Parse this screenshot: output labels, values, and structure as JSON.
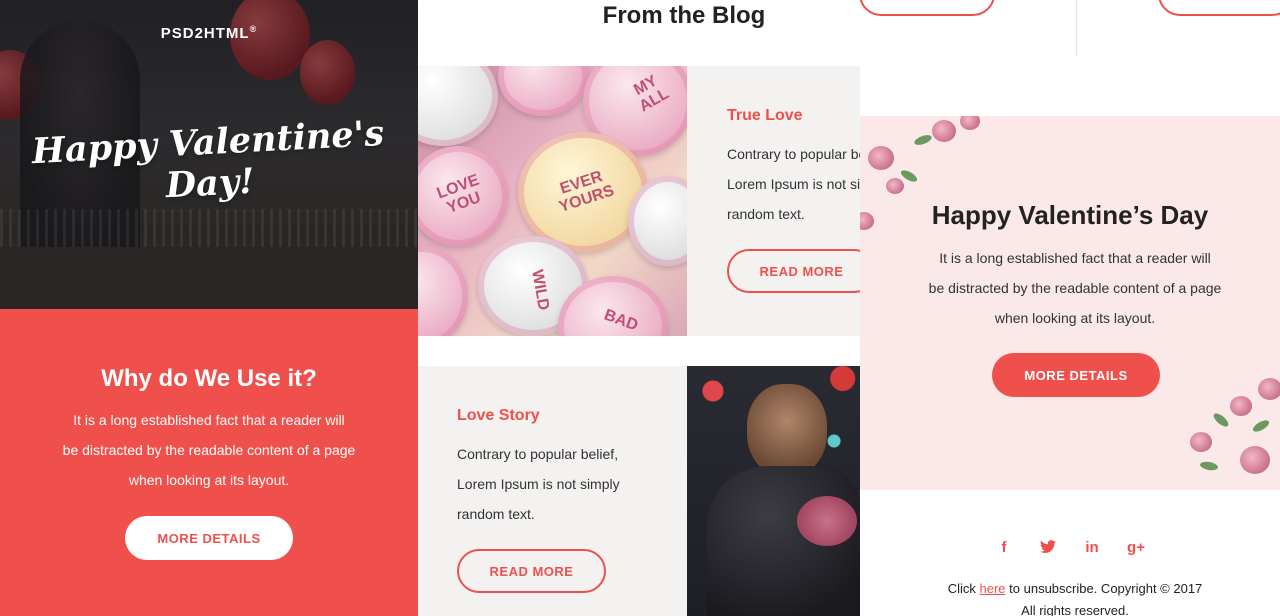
{
  "hero": {
    "logo": "PSD2HTML",
    "logo_mark": "®",
    "title": "Happy Valentine's Day!"
  },
  "why": {
    "title": "Why do We Use it?",
    "text": [
      "It is a long established fact that a reader will",
      "be distracted by the readable content of a page",
      "when looking at its layout."
    ],
    "button": "MORE DETAILS"
  },
  "blog": {
    "title": "From the Blog",
    "candy_words": [
      "EVER YOURS",
      "LOVE YOU",
      "BAD",
      "MY ALL",
      "WILD"
    ],
    "posts": [
      {
        "title": "True Love",
        "text": [
          "Contrary to popular belief,",
          "Lorem Ipsum is not simply",
          "random text."
        ],
        "button": "READ MORE"
      },
      {
        "title": "Love Story",
        "text": [
          "Contrary to popular belief,",
          "Lorem Ipsum is not simply",
          "random text."
        ],
        "button": "READ MORE"
      }
    ]
  },
  "promo": {
    "title": "Happy Valentine’s Day",
    "text": [
      "It is a long established fact that a reader will",
      "be distracted by the readable content of a page",
      "when looking at its layout."
    ],
    "button": "MORE DETAILS"
  },
  "social": {
    "icons": [
      "facebook-icon",
      "twitter-icon",
      "linkedin-icon",
      "google-plus-icon"
    ],
    "glyphs": {
      "facebook": "f",
      "twitter": "t",
      "linkedin": "in",
      "google_plus": "g+"
    }
  },
  "footer": {
    "prefix": "Click",
    "link": "here",
    "suffix": "to unsubscribe. Copyright © 2017",
    "line2": "All rights reserved."
  },
  "colors": {
    "accent": "#f0504c",
    "promo_bg": "#fbe9ea",
    "card_bg": "#f4f2f0"
  }
}
